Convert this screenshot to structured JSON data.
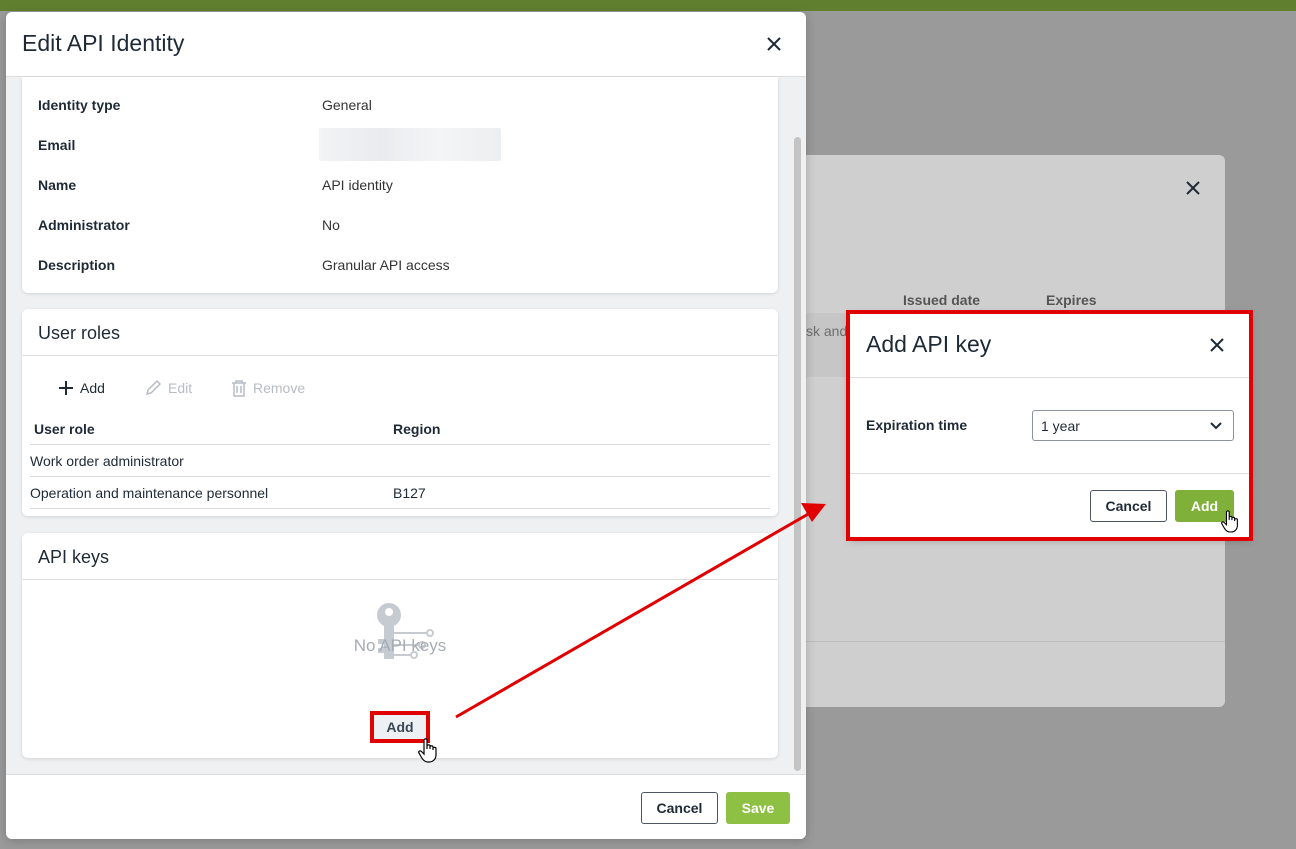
{
  "colors": {
    "topbar": "#61802f",
    "primary_green": "#8dc043",
    "highlight_red": "#e00000",
    "disabled_text": "#b7bcc3"
  },
  "background_modal": {
    "columns": [
      "Issued date",
      "Expires"
    ],
    "row_fragment": "sk and"
  },
  "edit_modal": {
    "title": "Edit API Identity",
    "details": [
      {
        "label": "Identity type",
        "value": "General"
      },
      {
        "label": "Email",
        "value": ""
      },
      {
        "label": "Name",
        "value": "API identity"
      },
      {
        "label": "Administrator",
        "value": "No"
      },
      {
        "label": "Description",
        "value": "Granular API access"
      }
    ],
    "user_roles": {
      "title": "User roles",
      "toolbar": {
        "add": "Add",
        "edit": "Edit",
        "remove": "Remove"
      },
      "columns": [
        "User role",
        "Region"
      ],
      "rows": [
        {
          "role": "Work order administrator",
          "region": ""
        },
        {
          "role": "Operation and maintenance personnel",
          "region": "B127"
        }
      ]
    },
    "api_keys": {
      "title": "API keys",
      "empty_text": "No API keys",
      "add_label": "Add"
    },
    "footer": {
      "cancel": "Cancel",
      "save": "Save"
    }
  },
  "add_key_dialog": {
    "title": "Add API key",
    "expiration_label": "Expiration time",
    "expiration_value": "1 year",
    "cancel": "Cancel",
    "add": "Add"
  },
  "icons": [
    "close-icon",
    "plus-icon",
    "pencil-icon",
    "trash-icon",
    "key-icon",
    "chevron-down-icon",
    "hand-cursor-icon"
  ]
}
